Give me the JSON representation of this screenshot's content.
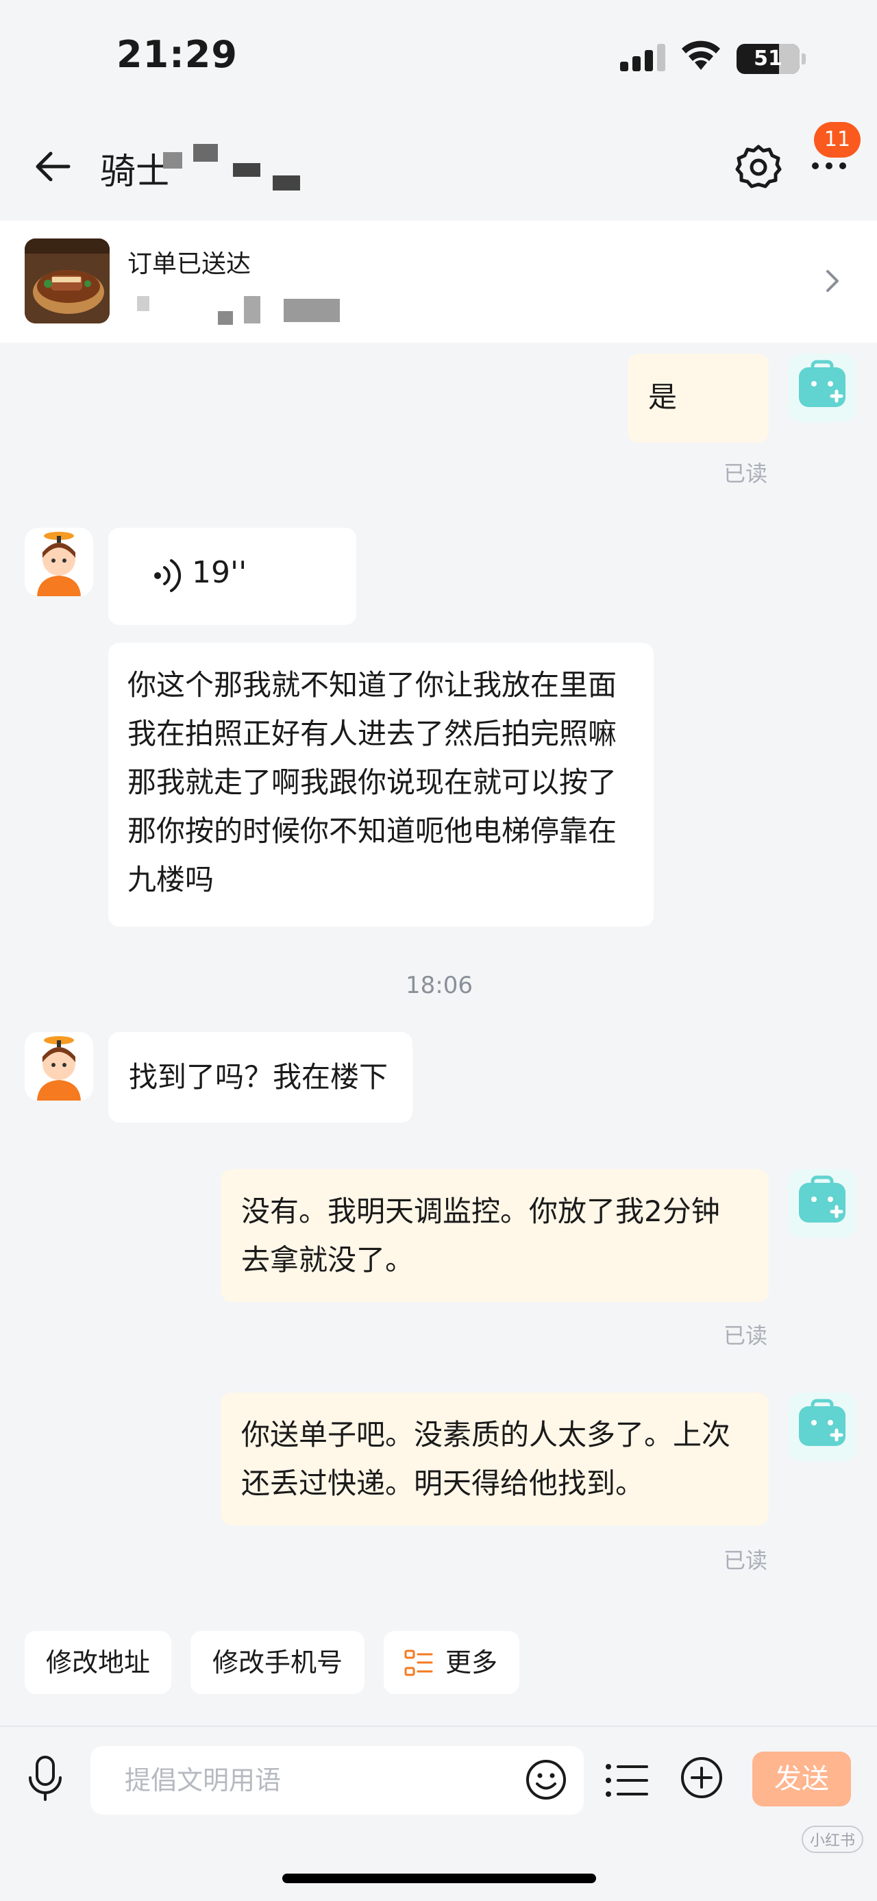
{
  "status_bar": {
    "time": "21:29",
    "battery": "51"
  },
  "header": {
    "title": "骑士",
    "notif_count": "11"
  },
  "order": {
    "status": "订单已送达"
  },
  "messages": {
    "m1": {
      "text": "是",
      "read": "已读"
    },
    "voice": {
      "duration": "19''"
    },
    "m2": {
      "text": "你这个那我就不知道了你让我放在里面我在拍照正好有人进去了然后拍完照嘛那我就走了啊我跟你说现在就可以按了那你按的时候你不知道呃他电梯停靠在九楼吗"
    },
    "timestamp": "18:06",
    "m3": {
      "text": "找到了吗？我在楼下"
    },
    "m4": {
      "text": "没有。我明天调监控。你放了我2分钟去拿就没了。",
      "read": "已读"
    },
    "m5": {
      "text": "你送单子吧。没素质的人太多了。上次还丢过快递。明天得给他找到。",
      "read": "已读"
    }
  },
  "quick_actions": {
    "change_address": "修改地址",
    "change_phone": "修改手机号",
    "more": "更多"
  },
  "input_bar": {
    "placeholder": "提倡文明用语",
    "send": "发送"
  },
  "watermark": "小红书",
  "colors": {
    "accent": "#fa5a1e",
    "bubble_me": "#fff7e8",
    "send_button": "#ffb58e",
    "background": "#f4f5f7"
  },
  "icons": [
    "back-arrow-icon",
    "gear-icon",
    "more-dots-icon",
    "chevron-right-icon",
    "voice-wave-icon",
    "mic-icon",
    "emoji-icon",
    "list-icon",
    "plus-circle-icon"
  ]
}
